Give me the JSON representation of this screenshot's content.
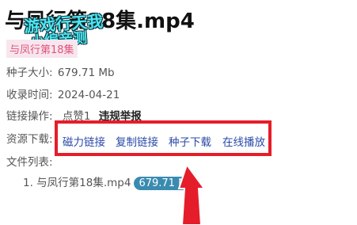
{
  "header": {
    "title": "与凤行第18集.mp4",
    "tag": "与凤行第18集"
  },
  "overlay": {
    "line1": "游戏行天我",
    "line2": "小编亲测"
  },
  "info": {
    "size_label": "种子大小:",
    "size_value": "679.71 Mb",
    "date_label": "收录时间:",
    "date_value": "2024-04-21",
    "ops_label": "链接操作:",
    "like": "点赞1",
    "report": "违规举报",
    "download_label": "资源下载:"
  },
  "links": [
    "磁力链接",
    "复制链接",
    "种子下载",
    "在线播放"
  ],
  "files": {
    "label": "文件列表:",
    "items": [
      {
        "name": "1. 与凤行第18集.mp4",
        "size": "679.71 Mb"
      }
    ]
  },
  "colors": {
    "highlight_box": "#e51d2a",
    "link": "#2a4aa8",
    "badge": "#3a8bb0"
  }
}
